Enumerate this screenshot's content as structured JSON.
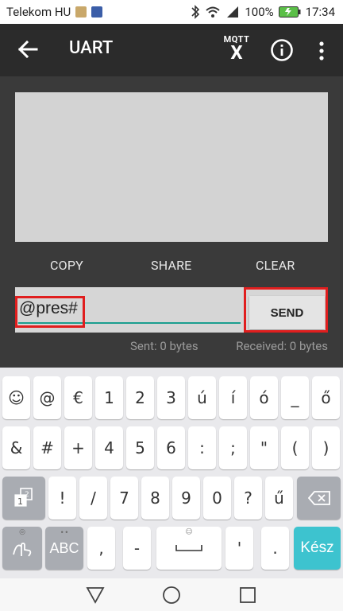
{
  "status_bar": {
    "carrier": "Telekom HU",
    "battery_percent": "100%",
    "time": "17:34"
  },
  "app_bar": {
    "title": "UART",
    "mqtt_label_top": "MQTT",
    "mqtt_label_bottom": "X"
  },
  "actions": {
    "copy": "COPY",
    "share": "SHARE",
    "clear": "CLEAR"
  },
  "input": {
    "value": "@pres#",
    "send_label": "SEND"
  },
  "counters": {
    "sent": "Sent: 0 bytes",
    "received": "Received: 0 bytes"
  },
  "keyboard": {
    "row1": [
      "☺",
      "@",
      "€",
      "1",
      "2",
      "3",
      "ú",
      "í",
      "ó",
      "_",
      "ő"
    ],
    "row2": [
      "&",
      "#",
      "+",
      "4",
      "5",
      "6",
      ":",
      ";",
      "\"",
      "(",
      ")"
    ],
    "row3": [
      "!",
      "/",
      "7",
      "8",
      "9",
      "0",
      "?",
      "ű"
    ],
    "row4_abc": "ABC",
    "row4_comma": ",",
    "row4_dash": "-",
    "row4_space_hint": "☺",
    "row4_apos": "'",
    "row4_dot": ".",
    "enter": "Kész"
  },
  "colors": {
    "accent": "#1a9e8f",
    "highlight": "#e01e1e",
    "enter_key": "#3dc3cf"
  }
}
